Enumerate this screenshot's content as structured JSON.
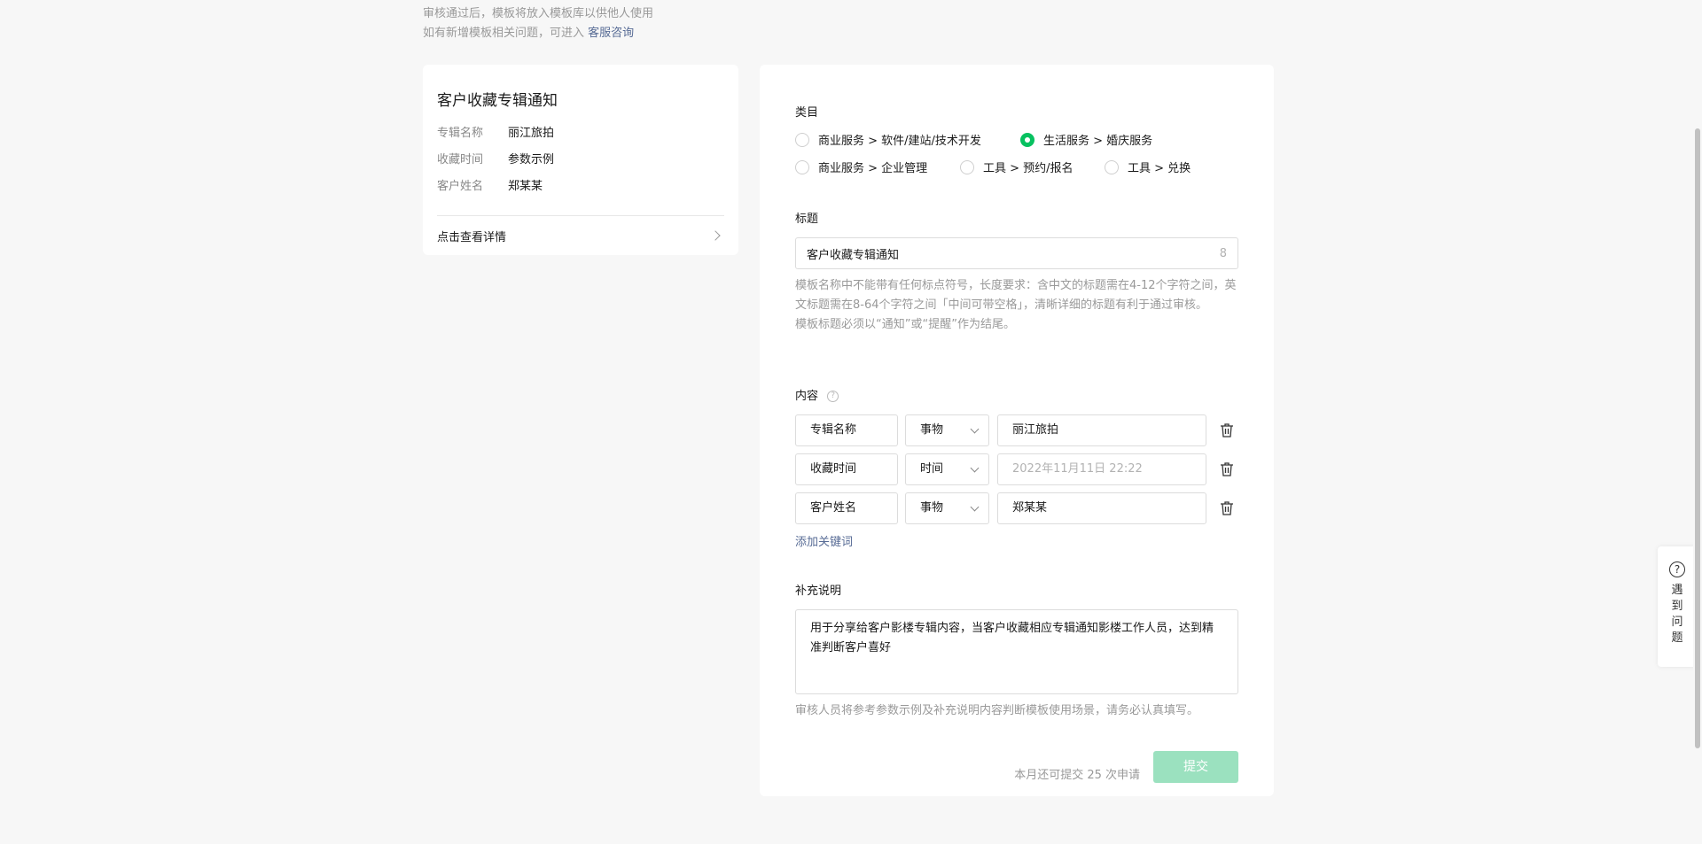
{
  "notes": {
    "line1": "审核通过后，模板将放入模板库以供他人使用",
    "line2_prefix": "如有新增模板相关问题，可进入",
    "line2_link": "客服咨询"
  },
  "preview": {
    "title": "客户收藏专辑通知",
    "rows": [
      {
        "k": "专辑名称",
        "v": "丽江旅拍"
      },
      {
        "k": "收藏时间",
        "v": "参数示例"
      },
      {
        "k": "客户姓名",
        "v": "郑某某"
      }
    ],
    "detail_label": "点击查看详情"
  },
  "category": {
    "label": "类目",
    "options": [
      {
        "label": "商业服务 > 软件/建站/技术开发",
        "checked": false
      },
      {
        "label": "生活服务 > 婚庆服务",
        "checked": true
      },
      {
        "label": "商业服务 > 企业管理",
        "checked": false
      },
      {
        "label": "工具 > 预约/报名",
        "checked": false
      },
      {
        "label": "工具 > 兑换",
        "checked": false
      }
    ]
  },
  "title_field": {
    "label": "标题",
    "value": "客户收藏专辑通知",
    "count": "8",
    "hint1": "模板名称中不能带有任何标点符号，长度要求：含中文的标题需在4-12个字符之间，英文标题需在8-64个字符之间「中间可带空格」，清晰详细的标题有利于通过审核。",
    "hint2": "模板标题必须以“通知”或“提醒”作为结尾。"
  },
  "content": {
    "label": "内容",
    "help_glyph": "?",
    "keywords": [
      {
        "name": "专辑名称",
        "type": "事物",
        "value": "丽江旅拍",
        "placeholder": false
      },
      {
        "name": "收藏时间",
        "type": "时间",
        "value": "2022年11月11日 22:22",
        "placeholder": true
      },
      {
        "name": "客户姓名",
        "type": "事物",
        "value": "郑某某",
        "placeholder": false
      }
    ],
    "add_label": "添加关键词"
  },
  "description": {
    "label": "补充说明",
    "value": "用于分享给客户影楼专辑内容，当客户收藏相应专辑通知影楼工作人员，达到精准判断客户喜好",
    "hint": "审核人员将参考参数示例及补充说明内容判断模板使用场景，请务必认真填写。"
  },
  "submit": {
    "note": "本月还可提交 25 次申请",
    "label": "提交",
    "color": "#9be1bf"
  },
  "float_help": {
    "glyph": "?",
    "text": "遇到问题"
  },
  "colors": {
    "accent": "#07c160",
    "link": "#576b95"
  }
}
